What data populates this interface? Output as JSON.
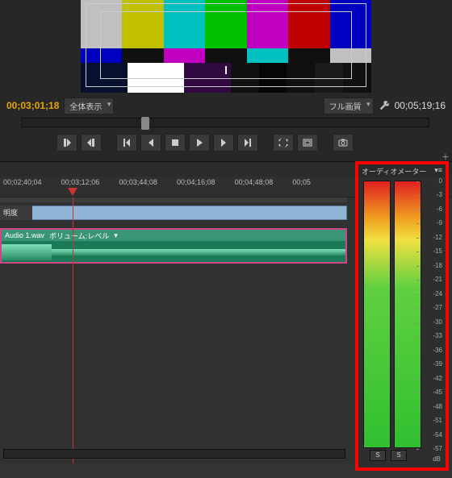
{
  "monitor": {
    "timecode_in": "00;03;01;18",
    "timecode_out": "00;05;19;16",
    "zoom_label": "全体表示",
    "quality_label": "フル画質",
    "color_bars": {
      "row1": [
        "#c0c0c0",
        "#c0c000",
        "#00c0c0",
        "#00c000",
        "#c000c0",
        "#c00000",
        "#0000c0"
      ],
      "row2": [
        "#0000c0",
        "#101010",
        "#c000c0",
        "#101010",
        "#00c0c0",
        "#101010",
        "#c0c0c0"
      ],
      "row3": [
        "#081030",
        "#ffffff",
        "#300a40",
        "#101010",
        "#060606",
        "#101010",
        "#1a1a1a",
        "#101010"
      ]
    }
  },
  "transport": {
    "mark_in": "mark_in",
    "mark_out": "mark_out",
    "go_in": "go_in",
    "go_out": "go_out",
    "prev": "prev",
    "back": "back",
    "play": "play",
    "stop": "stop",
    "fwd": "fwd",
    "next": "next",
    "loop": "loop",
    "safe": "safe",
    "snapshot": "snapshot"
  },
  "timeline": {
    "ruler_ticks": [
      "00;02;40;04",
      "00;03;12;06",
      "00;03;44;08",
      "00;04;16;08",
      "00;04;48;08",
      "00;05"
    ],
    "playhead_tc_index": 1,
    "video_track_label": "明度",
    "audio_clip": {
      "file": "Audio 1.wav",
      "param": "ボリューム:レベル"
    }
  },
  "meter": {
    "title": "オーディオメーター",
    "scale": [
      "0",
      "-3",
      "-6",
      "-9",
      "-12",
      "-15",
      "-18",
      "-21",
      "-24",
      "-27",
      "-30",
      "-33",
      "-36",
      "-39",
      "-42",
      "-45",
      "-48",
      "-51",
      "-54",
      "-57"
    ],
    "unit": "dB",
    "solo": "S"
  }
}
